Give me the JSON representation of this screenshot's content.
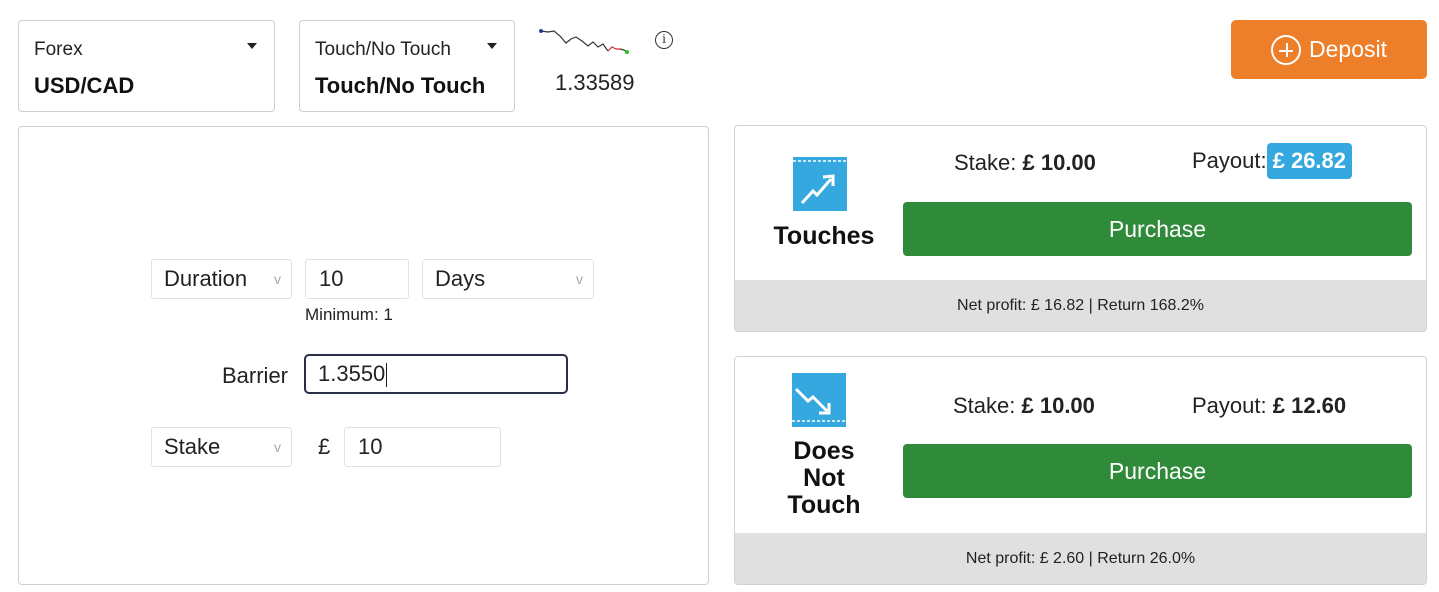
{
  "market": {
    "category": "Forex",
    "value": "USD/CAD"
  },
  "contract_type": {
    "category": "Touch/No Touch",
    "value": "Touch/No Touch"
  },
  "spot_price": "1.33589",
  "info_icon_glyph": "i",
  "deposit": {
    "label": "Deposit",
    "color": "#ee7f2a"
  },
  "form": {
    "duration_select": "Duration",
    "duration_value": "10",
    "duration_unit": "Days",
    "minimum_note": "Minimum: 1",
    "barrier_label": "Barrier",
    "barrier_value": "1.3550",
    "stake_select": "Stake",
    "currency_symbol": "£",
    "stake_value": "10",
    "caret_glyph": "v"
  },
  "contracts": [
    {
      "title": "Touches",
      "icon": "touches-arrow-up-icon",
      "stake_label": "Stake:",
      "stake_value": "£ 10.00",
      "payout_label": "Payout:",
      "payout_value": "£ 26.82",
      "purchase_label": "Purchase",
      "footer": "Net profit: £ 16.82 | Return 168.2%"
    },
    {
      "title_lines": [
        "Does",
        "Not",
        "Touch"
      ],
      "icon": "does-not-touch-arrow-down-icon",
      "stake_label": "Stake:",
      "stake_value": "£ 10.00",
      "payout_label": "Payout:",
      "payout_value": "£ 12.60",
      "purchase_label": "Purchase",
      "footer": "Net profit: £ 2.60 | Return 26.0%"
    }
  ],
  "colors": {
    "accent_blue": "#35a8e0",
    "purchase_green": "#2f8a39",
    "footer_gray": "#e0e0e0"
  }
}
